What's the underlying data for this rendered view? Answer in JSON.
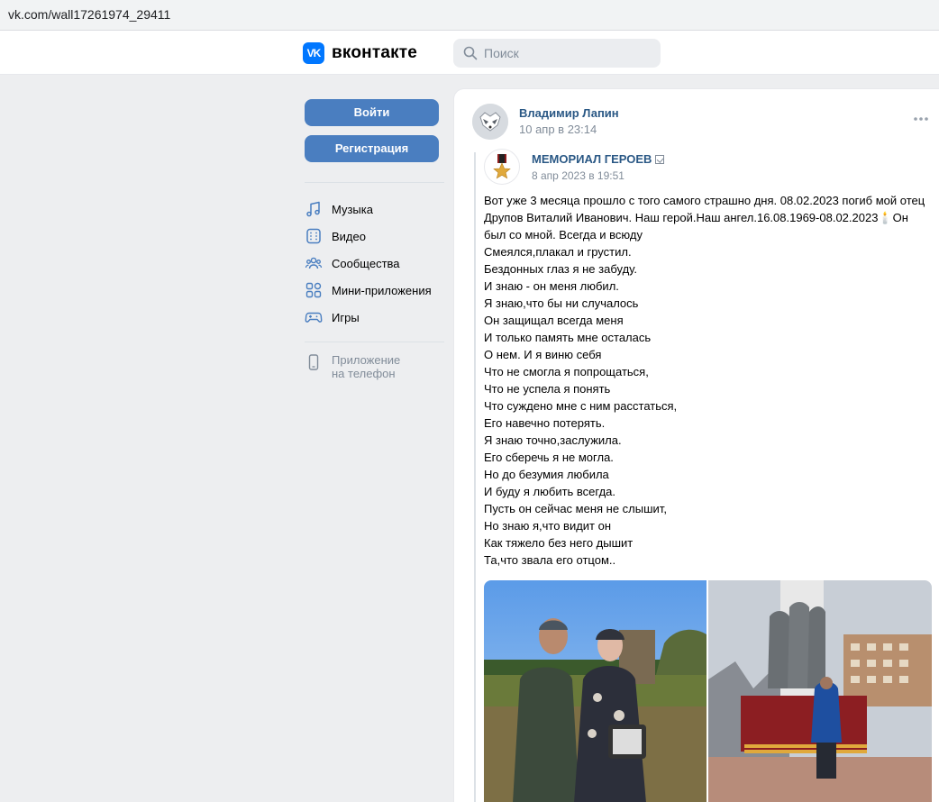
{
  "browser": {
    "url": "vk.com/wall17261974_29411"
  },
  "header": {
    "logo_text": "вконтакте",
    "logo_mark": "VK",
    "search_placeholder": "Поиск",
    "colors": {
      "brand": "#0077ff"
    }
  },
  "sidebar": {
    "login_label": "Войти",
    "register_label": "Регистрация",
    "items": [
      {
        "label": "Музыка",
        "icon": "music-icon"
      },
      {
        "label": "Видео",
        "icon": "video-icon"
      },
      {
        "label": "Сообщества",
        "icon": "communities-icon"
      },
      {
        "label": "Мини-приложения",
        "icon": "mini-apps-icon"
      },
      {
        "label": "Игры",
        "icon": "games-icon"
      }
    ],
    "app_line1": "Приложение",
    "app_line2": "на телефон",
    "colors": {
      "button": "#4a7ec0"
    }
  },
  "post": {
    "author": "Владимир Лапин",
    "date": "10 апр в 23:14",
    "repost": {
      "source": "МЕМОРИАЛ ГЕРОЕВ",
      "date": "8 апр 2023 в 19:51",
      "lines": [
        "Вот уже 3 месяца прошло с того самого страшно дня. 08.02.2023 погиб мой отец",
        "Друпов Виталий Иванович. Наш герой.Наш ангел.16.08.1969-08.02.2023🕯️Он",
        "был со мной. Всегда и всюду",
        "Смеялся,плакал и грустил.",
        "Бездонных глаз я не забуду.",
        "И знаю - он меня любил.",
        "Я знаю,что бы ни случалось",
        "Он защищал всегда меня",
        "И только память мне осталась",
        "О нем. И я виню себя",
        "Что не смогла я попрощаться,",
        "Что не успела я понять",
        "Что суждено мне с ним расстаться,",
        "Его навечно потерять.",
        "Я знаю точно,заслужила.",
        "Его сберечь я не могла.",
        "Но до безумия любила",
        "И буду я любить всегда.",
        "Пусть он сейчас меня не слышит,",
        "Но знаю я,что видит он",
        "Как тяжело без него дышит",
        "Та,что звала его отцом.."
      ]
    }
  }
}
